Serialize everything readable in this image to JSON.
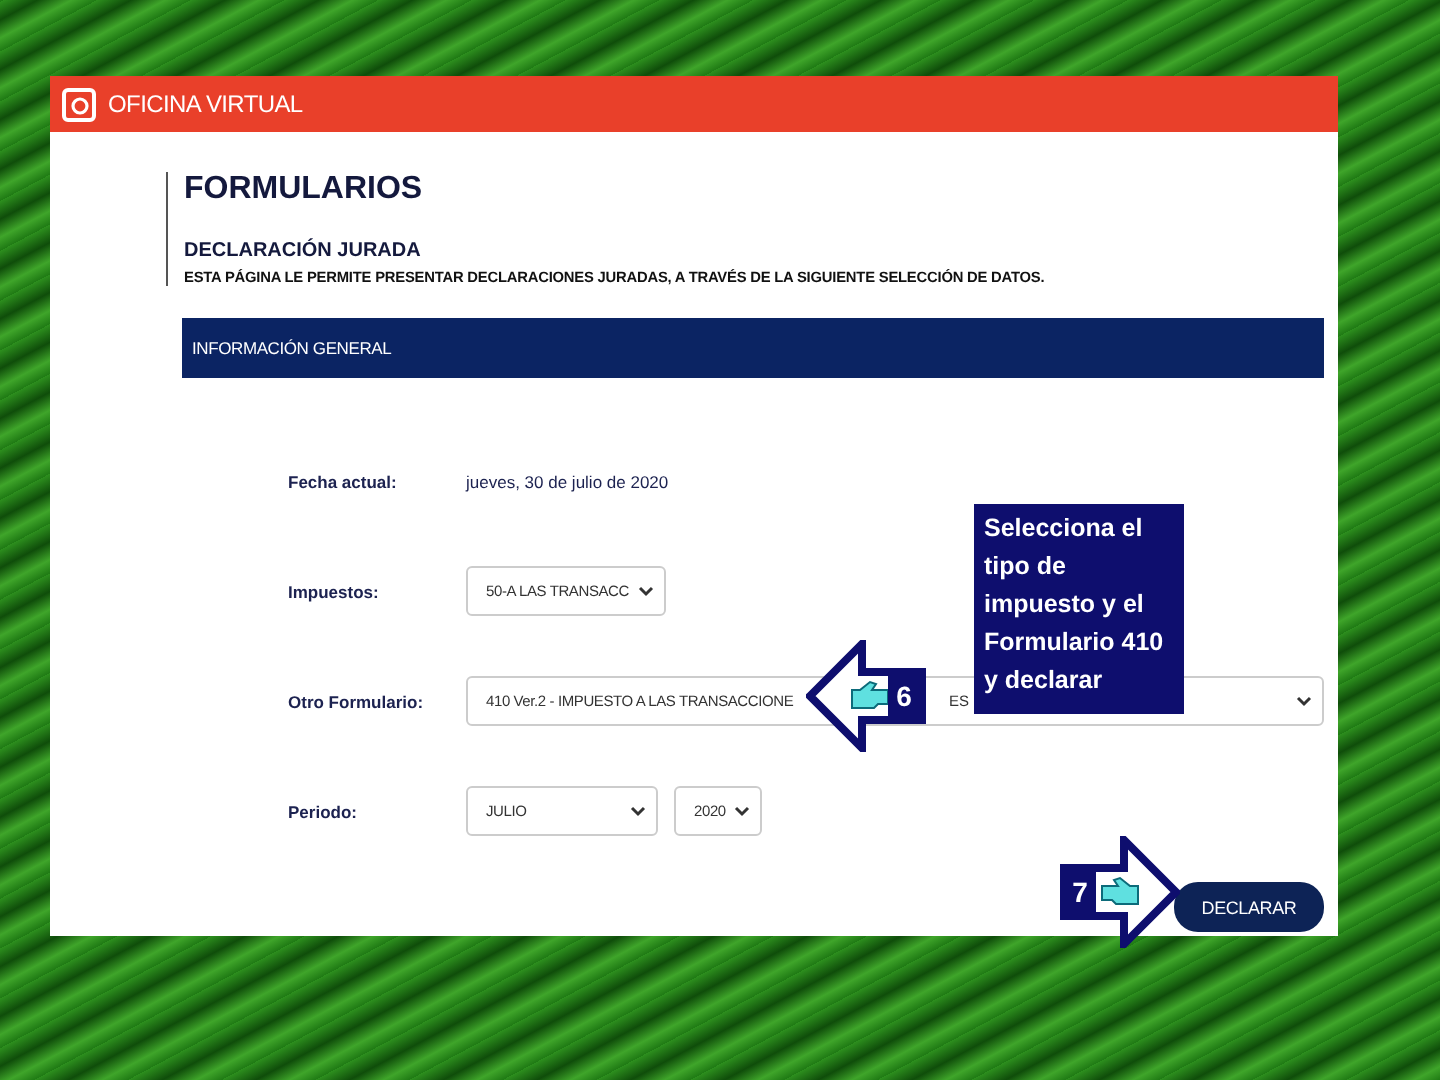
{
  "header": {
    "title": "OFICINA VIRTUAL"
  },
  "page": {
    "title": "FORMULARIOS",
    "subtitle": "DECLARACIÓN JURADA",
    "description": "ESTA PÁGINA LE PERMITE PRESENTAR DECLARACIONES JURADAS, A TRAVÉS DE LA SIGUIENTE SELECCIÓN DE DATOS."
  },
  "section": {
    "title": "INFORMACIÓN GENERAL"
  },
  "fields": [
    {
      "kind": "text",
      "label": "Fecha actual:",
      "value": "jueves, 30 de julio de 2020"
    },
    {
      "kind": "select",
      "label": "Impuestos:",
      "selects": [
        {
          "wide": false,
          "value": "50-A LAS TRANSACC"
        }
      ]
    },
    {
      "kind": "select",
      "label": "Otro Formulario:",
      "selects": [
        {
          "wide": true,
          "value": "410 Ver.2 - IMPUESTO A LAS TRANSACCIONE",
          "value_tail": "ES"
        }
      ]
    },
    {
      "kind": "select",
      "label": "Periodo:",
      "selects": [
        {
          "wide": false,
          "value": "JULIO"
        },
        {
          "wide": false,
          "value": "2020"
        }
      ]
    }
  ],
  "button": {
    "label": "DECLARAR"
  },
  "note": {
    "text": "Selecciona el tipo de impuesto y el Formulario 410 y declarar"
  },
  "callouts": [
    {
      "kind": "arrow_left",
      "number": "6"
    },
    {
      "kind": "arrow_right",
      "number": "7"
    }
  ]
}
